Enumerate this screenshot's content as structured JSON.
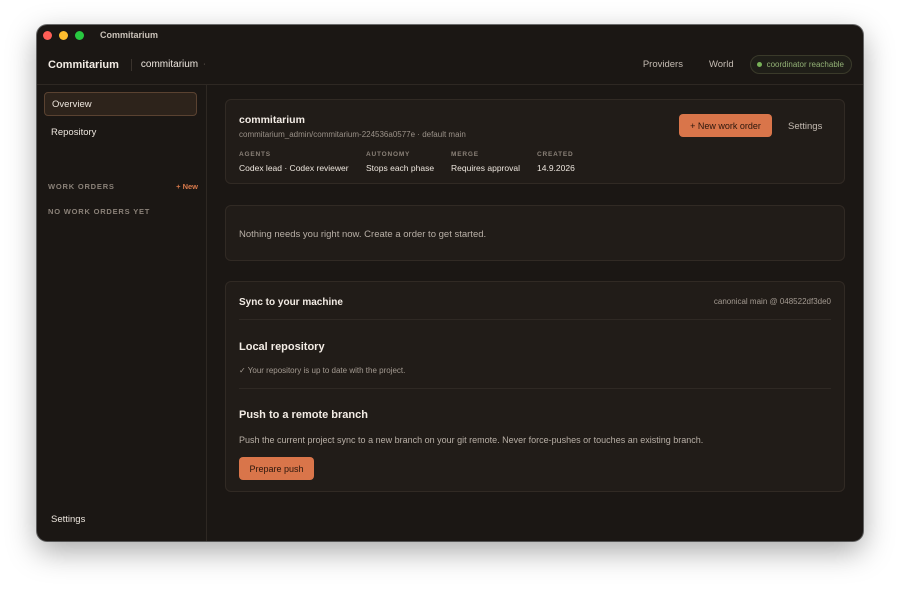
{
  "window": {
    "title": "Commitarium"
  },
  "appbar": {
    "brand": "Commitarium",
    "project": "commitarium",
    "project_caret": "·",
    "nav": [
      "Providers",
      "World"
    ],
    "status": "coordinator reachable",
    "status_color": "#78b258"
  },
  "sidebar": {
    "items": [
      {
        "label": "Overview",
        "active": true
      },
      {
        "label": "Repository",
        "active": false
      }
    ],
    "section_label": "WORK ORDERS",
    "new_label": "+ New",
    "empty_label": "NO WORK ORDERS YET",
    "settings_label": "Settings"
  },
  "project_card": {
    "name": "commitarium",
    "path": "commitarium_admin/commitarium-224536a0577e · default main",
    "new_work_order_label": "+ New work order",
    "settings_label": "Settings",
    "meta": [
      {
        "label": "AGENTS",
        "value": "Codex lead · Codex reviewer"
      },
      {
        "label": "AUTONOMY",
        "value": "Stops each phase"
      },
      {
        "label": "MERGE",
        "value": "Requires approval"
      },
      {
        "label": "CREATED",
        "value": "14.9.2026"
      }
    ]
  },
  "notice": {
    "text": "Nothing needs you right now. Create a order to get started."
  },
  "sync": {
    "title": "Sync to your machine",
    "canonical": "canonical main @ 048522df3de0",
    "local_title": "Local repository",
    "local_status": "✓ Your repository is up to date with the project.",
    "push_title": "Push to a remote branch",
    "push_desc": "Push the current project sync to a new branch on your git remote. Never force-pushes or touches an existing branch.",
    "prepare_label": "Prepare push"
  },
  "colors": {
    "accent": "#d9754a",
    "background": "#1b1714",
    "card": "#211c18",
    "status_green": "#78b258"
  }
}
